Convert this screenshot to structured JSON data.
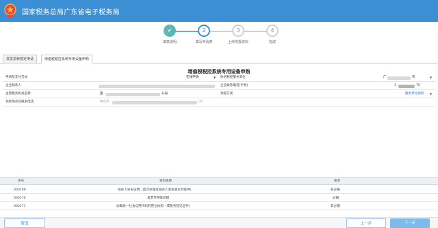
{
  "header": {
    "title": "国家税务总局广东省电子税务局",
    "logo_icon": "tax-emblem-icon"
  },
  "steps": [
    {
      "number": "✔",
      "label": "填表说明",
      "state": "done"
    },
    {
      "number": "2",
      "label": "填写申请表",
      "state": "active"
    },
    {
      "number": "3",
      "label": "上传附报资料",
      "state": "pending"
    },
    {
      "number": "4",
      "label": "完成",
      "state": "pending"
    }
  ],
  "tabs": [
    {
      "label": "发票票种核定申请"
    },
    {
      "label": "增值税税控系统专用设备申购"
    }
  ],
  "form": {
    "title": "增值税税控系统专用设备申购",
    "rows": [
      {
        "l1": "申请及支付方式",
        "v1": "在线申请",
        "l2": "防伪税控服务单位",
        "v2": "广",
        "v2_tail": "司"
      },
      {
        "l1": "企业联系人",
        "v1": "",
        "l2": "企业联系电话(手机)",
        "v2": "1",
        "v2_tail": "75"
      },
      {
        "l1": "主管税务机关名称",
        "v1": "国",
        "v1_tail": "分局",
        "l2": "领取方式",
        "v2": "服务单位领取"
      },
      {
        "l1": "领取地点及联系电话",
        "v1": "中山市",
        "v1_tail": "(0)"
      }
    ]
  },
  "attachments": {
    "headers": [
      "序号",
      "资料名称",
      "要求"
    ],
    "rows": [
      {
        "no": "000169",
        "name": "经办人身份证明（首次办理或经办人发生变化时提供）",
        "req": "非必报"
      },
      {
        "no": "000170",
        "name": "发票专用章印模",
        "req": "必报"
      },
      {
        "no": "000171",
        "name": "加载统一社会信用代码的营业执照（或税务登记证件）",
        "req": "非必报"
      }
    ]
  },
  "footer": {
    "cancel": "取消",
    "prev": "上一步",
    "next": "下一步"
  },
  "colors": {
    "header": "#3c8fd3",
    "step_done": "#5eb7b0",
    "link": "#3c6fc0"
  }
}
